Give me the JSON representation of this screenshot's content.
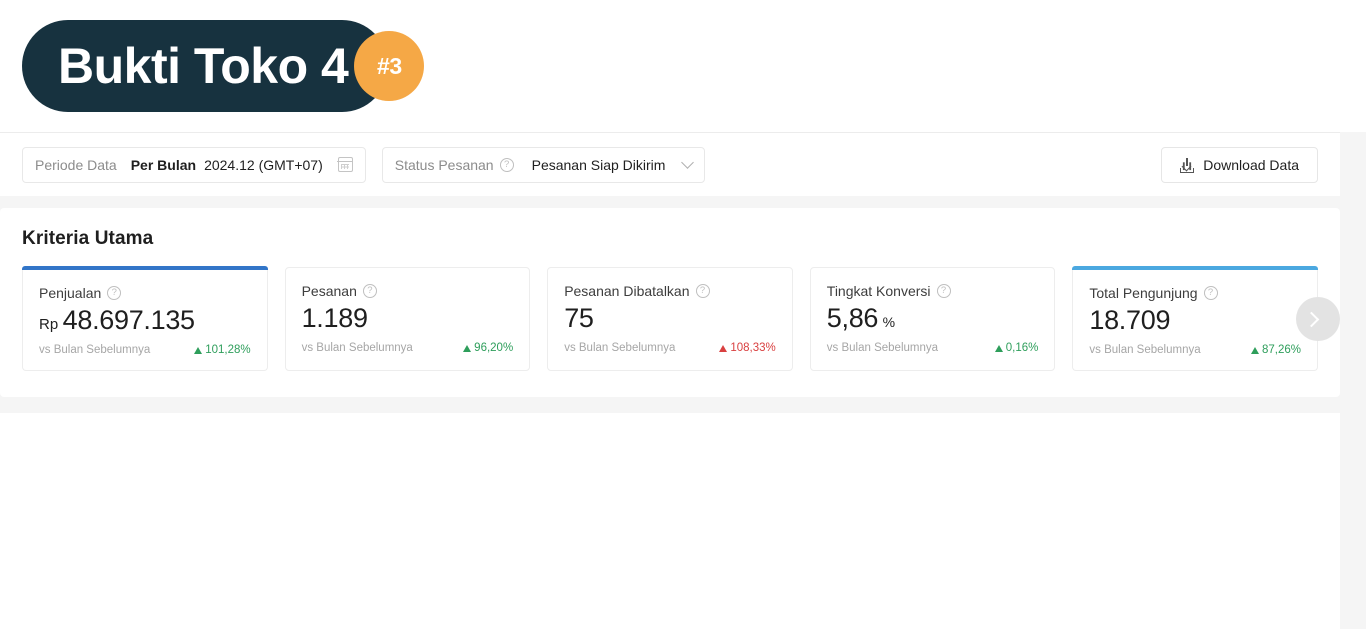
{
  "logo": {
    "title": "Bukti Toko 4",
    "badge": "#3",
    "pill_color": "#17323f",
    "badge_color": "#f5a846"
  },
  "filters": {
    "period": {
      "label": "Periode Data",
      "granularity": "Per Bulan",
      "value": "2024.12 (GMT+07)",
      "calendar_icon": "calendar-icon"
    },
    "order_status": {
      "label": "Status Pesanan",
      "help_icon": "help-circle-icon",
      "value": "Pesanan Siap Dikirim",
      "chevron_icon": "chevron-down-icon"
    },
    "download": {
      "label": "Download Data",
      "icon": "download-icon"
    }
  },
  "section": {
    "title": "Kriteria Utama",
    "next_icon": "chevron-right-icon"
  },
  "metrics": [
    {
      "label": "Penjualan",
      "help_icon": "help-circle-icon",
      "prefix": "Rp",
      "value": "48.697.135",
      "suffix": "",
      "compare_label": "vs Bulan Sebelumnya",
      "delta": "101,28%",
      "direction": "up",
      "accent": "#3275c8"
    },
    {
      "label": "Pesanan",
      "help_icon": "help-circle-icon",
      "prefix": "",
      "value": "1.189",
      "suffix": "",
      "compare_label": "vs Bulan Sebelumnya",
      "delta": "96,20%",
      "direction": "up",
      "accent": ""
    },
    {
      "label": "Pesanan Dibatalkan",
      "help_icon": "help-circle-icon",
      "prefix": "",
      "value": "75",
      "suffix": "",
      "compare_label": "vs Bulan Sebelumnya",
      "delta": "108,33%",
      "direction": "down",
      "accent": ""
    },
    {
      "label": "Tingkat Konversi",
      "help_icon": "help-circle-icon",
      "prefix": "",
      "value": "5,86",
      "suffix": "%",
      "compare_label": "vs Bulan Sebelumnya",
      "delta": "0,16%",
      "direction": "up",
      "accent": ""
    },
    {
      "label": "Total Pengunjung",
      "help_icon": "help-circle-icon",
      "prefix": "",
      "value": "18.709",
      "suffix": "",
      "compare_label": "vs Bulan Sebelumnya",
      "delta": "87,26%",
      "direction": "up",
      "accent": "#4ba8e0"
    }
  ]
}
